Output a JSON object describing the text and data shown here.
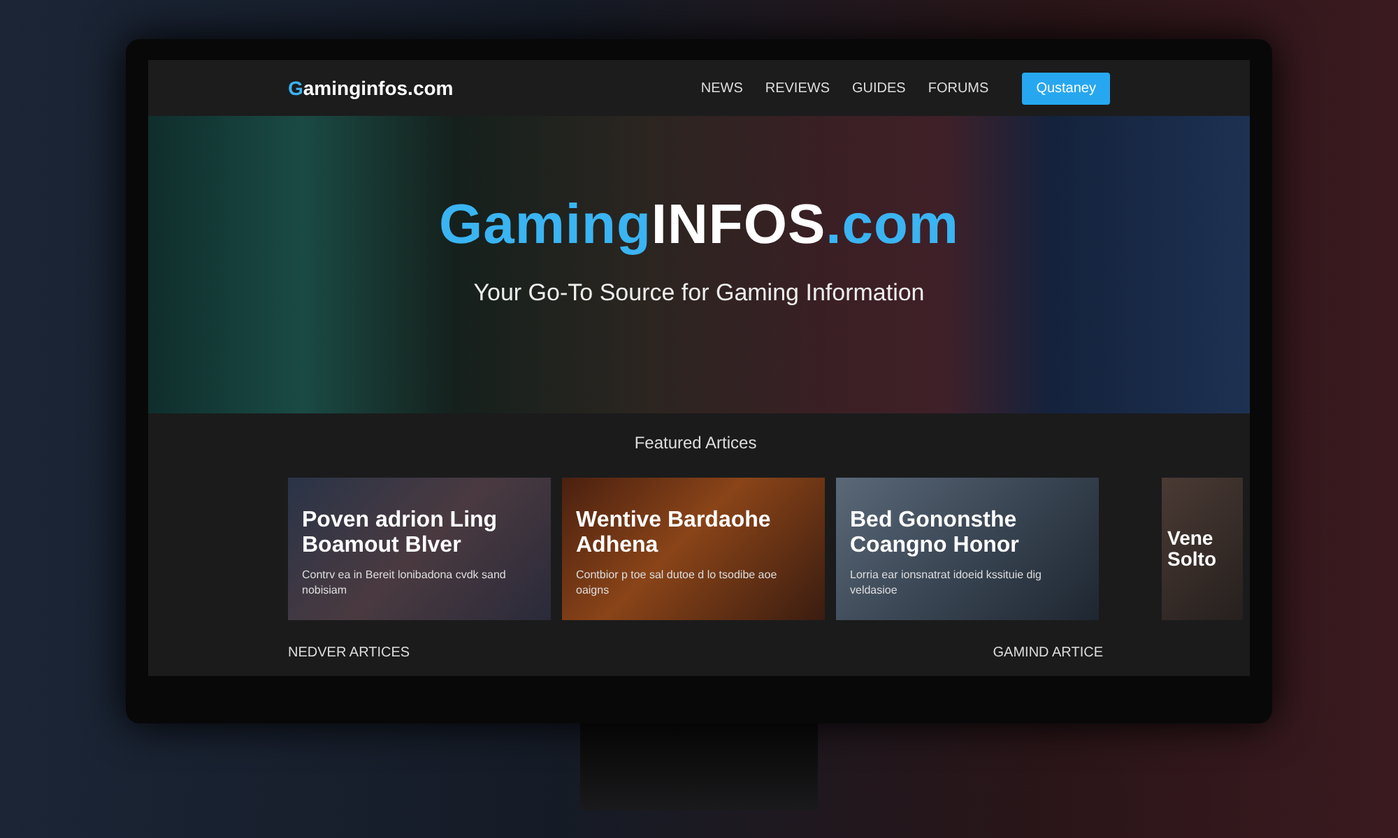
{
  "navbar": {
    "logo_parts": [
      {
        "text": "G",
        "accent": true
      },
      {
        "text": "aminginfos.com",
        "accent": false
      }
    ],
    "links": [
      {
        "label": "NEWS"
      },
      {
        "label": "REVIEWS"
      },
      {
        "label": "GUIDES"
      },
      {
        "label": "FORUMS"
      }
    ],
    "cta_button": "Qustaney"
  },
  "hero": {
    "title_parts": [
      {
        "text": "Gaming",
        "accent": true
      },
      {
        "text": "INFOS",
        "accent": false
      },
      {
        "text": ".com",
        "accent": true
      }
    ],
    "subtitle": "Your Go-To Source for Gaming Information"
  },
  "featured": {
    "heading": "Featured Artices",
    "cards": [
      {
        "title": "Poven adrion Ling Boamout Blver",
        "description": "Contrv ea in Bereit lonibadona cvdk sand nobisiam"
      },
      {
        "title": "Wentive Bardaohe Adhena",
        "description": "Contbior p toe sal dutoe d lo tsodibe aoe oaigns"
      },
      {
        "title": "Bed Gononsthe Coangno Honor",
        "description": "Lorria ear ionsnatrat idoeid kssituie dig veldasioe"
      }
    ],
    "cut_card": {
      "title": "Vene Solto"
    }
  },
  "sections": [
    {
      "label": "NEDVER ARTICES"
    },
    {
      "label": "GAMIND ARTICE"
    }
  ]
}
